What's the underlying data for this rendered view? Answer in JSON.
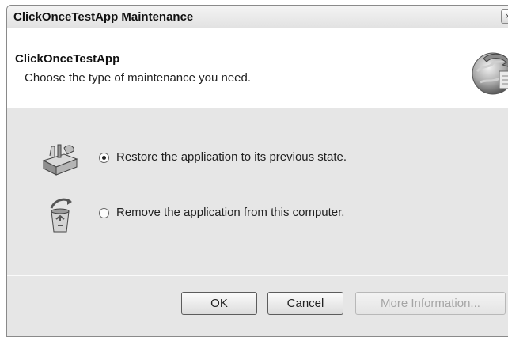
{
  "window": {
    "title": "ClickOnceTestApp Maintenance",
    "close_glyph": "×"
  },
  "header": {
    "app_name": "ClickOnceTestApp",
    "description": "Choose the type of maintenance you need.",
    "icon": "globe-arrow-icon"
  },
  "options": [
    {
      "label": "Restore the application to its previous state.",
      "selected": true,
      "icon": "toolbox-icon"
    },
    {
      "label": "Remove the application from this computer.",
      "selected": false,
      "icon": "recycle-bin-icon"
    }
  ],
  "buttons": {
    "ok": "OK",
    "cancel": "Cancel",
    "more_info": "More Information..."
  }
}
